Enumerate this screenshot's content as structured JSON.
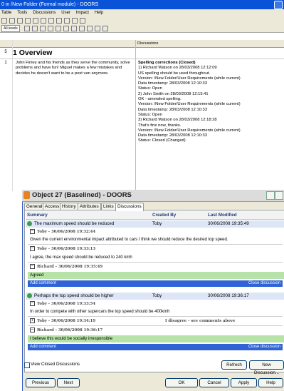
{
  "back_window": {
    "title": "0 in /New Folder (Formal module) - DOORS",
    "menu": [
      "Table",
      "Tools",
      "Discussions",
      "User",
      "Impact",
      "Help"
    ],
    "level_select": "All levels",
    "column_heading": "Discussions",
    "row5": {
      "num": "5",
      "heading": "1 Overview"
    },
    "row1": {
      "num": "1",
      "text": "John Finley and his friends as they serve the community, solve problems and have fun! Miguel makes a few mistakes and decides he doesn't want to be a post van anymore.",
      "discussion_lines": [
        "Spelling corrections (Closed)",
        "1) Richard Watson  on 28/03/2008 12:12:09",
        "US spelling should be used throughout.",
        "Version: /New Folder/User Requirements  (while current)",
        "Data timestamp: 28/03/2008 12:10:33",
        "Status: Open",
        "2) John Smith  on 28/03/2008 12:15:41",
        "OK - amended spelling.",
        "Version: /New Folder/User Requirements  (while current)",
        "Data timestamp: 28/03/2008 12:10:33",
        "Status: Open",
        "3) Richard Watson  on 28/03/2008 12:18:28",
        "That's fine now, thanks.",
        "Version: /New Folder/User Requirements  (while current)",
        "Data timestamp: 28/03/2008 12:10:33",
        "Status: Closed (Changed)"
      ]
    }
  },
  "dialog": {
    "title": "Object 27 (Baselined) - DOORS",
    "tabs": [
      "General",
      "Access",
      "History",
      "Attributes",
      "Links",
      "Discussions"
    ],
    "active_tab": "Discussions",
    "columns": {
      "summary": "Summary",
      "created_by": "Created By",
      "last_modified": "Last Modified"
    },
    "discussions": [
      {
        "summary": "The maximum speed should be reduced",
        "created_by": "Toby",
        "last_modified": "30/06/2008 19:35:49",
        "comments": [
          {
            "header": "Toby - 30/06/2008 19:32:44",
            "body": "Given the current environmental impact attributed to cars I think we should reduce the desired top speed."
          },
          {
            "header": "Toby - 30/06/2008 19:33:13",
            "body": "I agree, the max speed should be reduced to 240 kmh"
          },
          {
            "header": "Richard - 30/06/2008 19:35:49",
            "body": "Agreed"
          }
        ],
        "add_comment": "Add comment",
        "close_discussion": "Close discussion"
      },
      {
        "summary": "Perhaps the top speed should be higher",
        "created_by": "Toby",
        "last_modified": "30/06/2008 19:36:17",
        "comments": [
          {
            "header": "Toby - 30/06/2008 19:33:54",
            "body": "In order to compete with other supercars the top speed should be 400kmh"
          },
          {
            "header": "Toby - 30/06/2008 19:34:19",
            "body": "I disagree - see comments above"
          },
          {
            "header": "Richard - 30/06/2008 19:36:17",
            "body": "I believe this would be socially irresponsible"
          }
        ],
        "add_comment": "Add comment",
        "close_discussion": "Close discussion"
      }
    ],
    "view_closed": "View Closed Discussions",
    "refresh": "Refresh",
    "new_discussion": "New Discussion...",
    "previous": "Previous",
    "next": "Next",
    "ok": "OK",
    "cancel": "Cancel",
    "apply": "Apply",
    "help": "Help"
  },
  "colors": {
    "titlebar": "#0a53d6",
    "topic_row": "#dce6f6",
    "green_comment": "#b8e3a8",
    "action_bar": "#2f63d6"
  }
}
